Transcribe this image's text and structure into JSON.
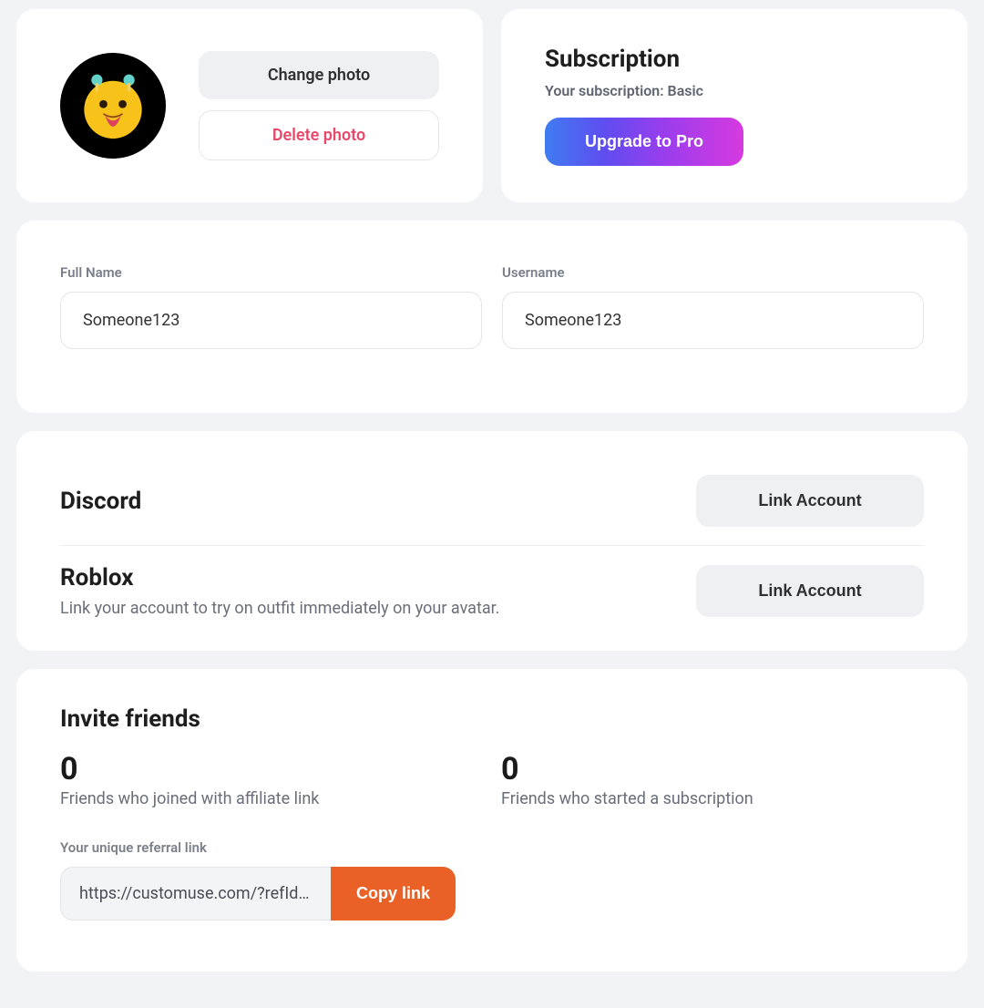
{
  "photo": {
    "change_label": "Change photo",
    "delete_label": "Delete photo"
  },
  "subscription": {
    "title": "Subscription",
    "status": "Your subscription: Basic",
    "upgrade_label": "Upgrade to Pro"
  },
  "profile": {
    "full_name_label": "Full Name",
    "full_name_value": "Someone123",
    "username_label": "Username",
    "username_value": "Someone123"
  },
  "accounts": {
    "discord": {
      "title": "Discord",
      "link_label": "Link Account"
    },
    "roblox": {
      "title": "Roblox",
      "description": "Link your account to try on outfit immediately on your avatar.",
      "link_label": "Link Account"
    }
  },
  "invite": {
    "title": "Invite friends",
    "stat1_value": "0",
    "stat1_label": "Friends who joined with affiliate link",
    "stat2_value": "0",
    "stat2_label": "Friends who started a subscription",
    "referral_label": "Your unique referral link",
    "referral_value": "https://customuse.com/?refId=…",
    "copy_label": "Copy link"
  }
}
